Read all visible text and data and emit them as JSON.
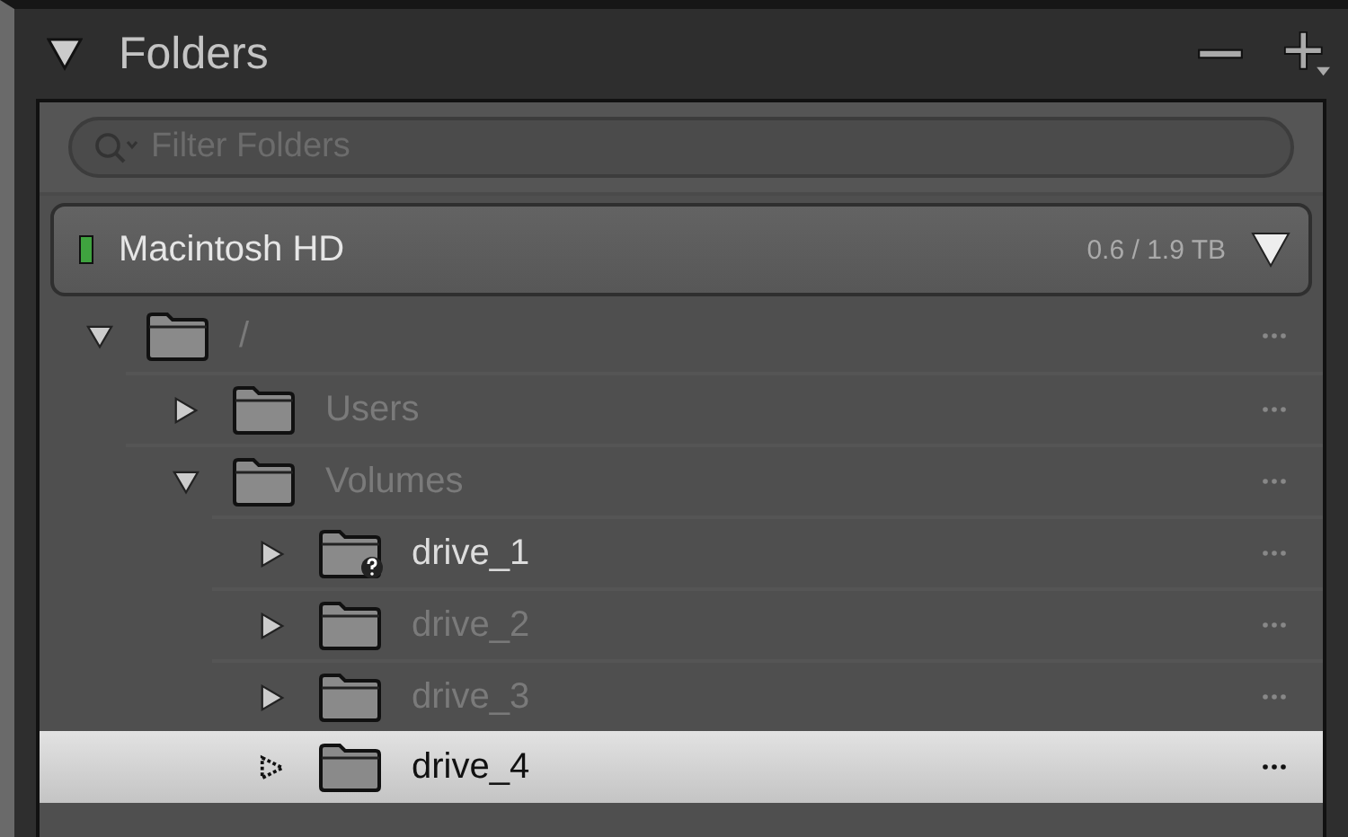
{
  "panel": {
    "title": "Folders",
    "expanded": true
  },
  "filter": {
    "placeholder": "Filter Folders"
  },
  "volume": {
    "name": "Macintosh HD",
    "usage": "0.6 / 1.9 TB",
    "color": "#3fa33f",
    "expanded": true
  },
  "tree": [
    {
      "name": "/",
      "expanded": true,
      "selected": false,
      "dimmed": true,
      "missing": false,
      "children": [
        {
          "name": "Users",
          "expanded": false,
          "selected": false,
          "dimmed": true,
          "missing": false
        },
        {
          "name": "Volumes",
          "expanded": true,
          "selected": false,
          "dimmed": true,
          "missing": false,
          "children": [
            {
              "name": "drive_1",
              "expanded": false,
              "selected": false,
              "dimmed": false,
              "missing": true
            },
            {
              "name": "drive_2",
              "expanded": false,
              "selected": false,
              "dimmed": true,
              "missing": false
            },
            {
              "name": "drive_3",
              "expanded": false,
              "selected": false,
              "dimmed": true,
              "missing": false
            },
            {
              "name": "drive_4",
              "expanded": false,
              "selected": true,
              "dimmed": false,
              "missing": false
            }
          ]
        }
      ]
    }
  ]
}
